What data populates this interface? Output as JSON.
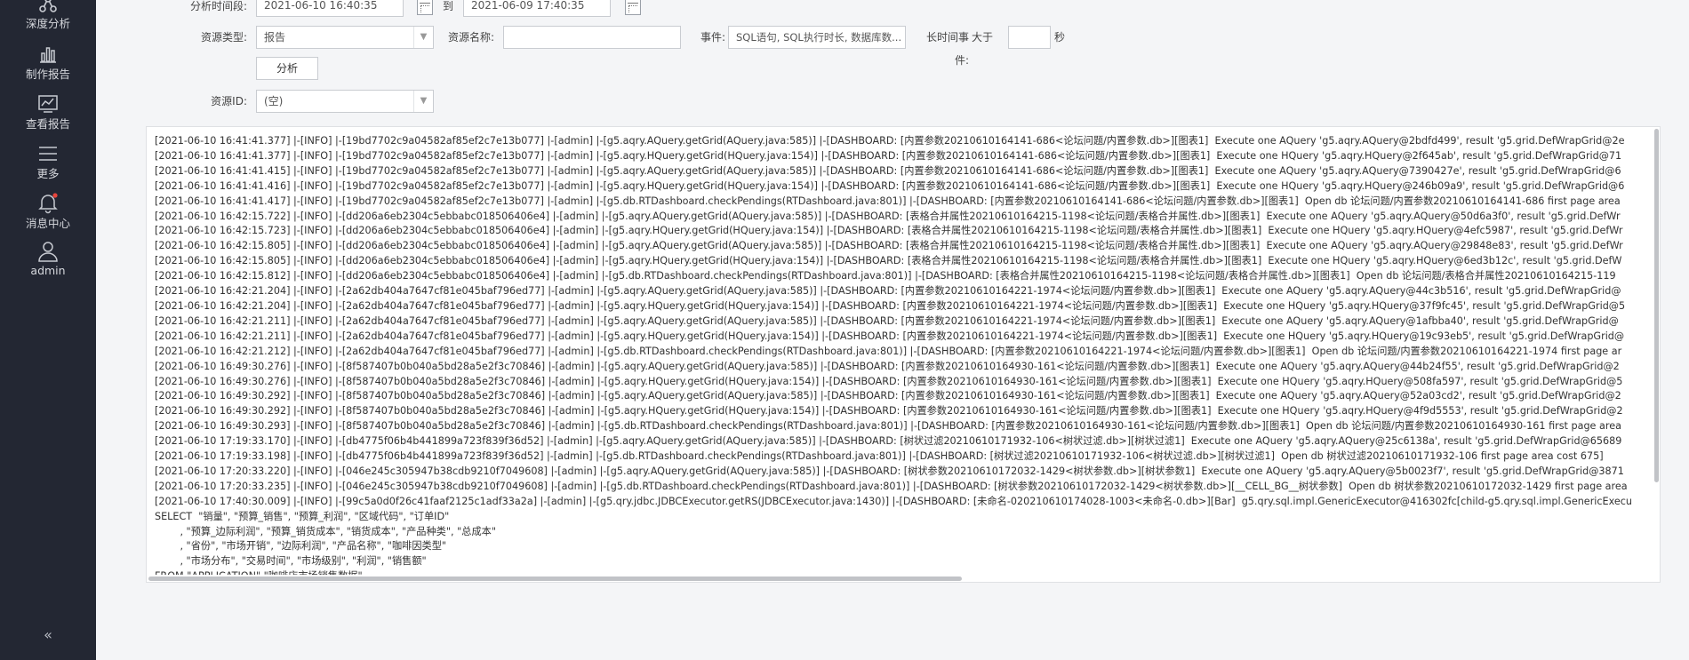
{
  "sidebar": {
    "items": [
      {
        "label": "深度分析",
        "icon": "analysis-icon"
      },
      {
        "label": "制作报告",
        "icon": "bar-chart-icon"
      },
      {
        "label": "查看报告",
        "icon": "line-chart-icon"
      },
      {
        "label": "更多",
        "icon": "menu-icon"
      },
      {
        "label": "消息中心",
        "icon": "bell-icon"
      },
      {
        "label": "admin",
        "icon": "user-icon"
      }
    ],
    "collapse_label": "«"
  },
  "form": {
    "time_label": "分析时间段:",
    "start_time": "2021-06-10 16:40:35",
    "to_label": "到",
    "end_time": "2021-06-09 17:40:35",
    "resource_type_label": "资源类型:",
    "resource_type_value": "报告",
    "resource_name_label": "资源名称:",
    "resource_name_value": "",
    "event_label": "事件:",
    "event_value": "SQL语句, SQL执行时长, 数据库数...",
    "long_event_label": "长时间事件:",
    "greater_label": "大于",
    "long_event_value": "",
    "seconds_label": "秒",
    "analyze_button": "分析",
    "resource_id_label": "资源ID:",
    "resource_id_value": "(空)"
  },
  "log": {
    "lines": [
      "[2021-06-10 16:41:41.377] |-[INFO] |-[19bd7702c9a04582af85ef2c7e13b077] |-[admin] |-[g5.aqry.AQuery.getGrid(AQuery.java:585)] |-[DASHBOARD: [内置参数20210610164141-686<论坛问题/内置参数.db>][图表1]  Execute one AQuery 'g5.aqry.AQuery@2bdfd499', result 'g5.grid.DefWrapGrid@2e",
      "[2021-06-10 16:41:41.377] |-[INFO] |-[19bd7702c9a04582af85ef2c7e13b077] |-[admin] |-[g5.aqry.HQuery.getGrid(HQuery.java:154)] |-[DASHBOARD: [内置参数20210610164141-686<论坛问题/内置参数.db>][图表1]  Execute one HQuery 'g5.aqry.HQuery@2f645ab', result 'g5.grid.DefWrapGrid@71",
      "[2021-06-10 16:41:41.415] |-[INFO] |-[19bd7702c9a04582af85ef2c7e13b077] |-[admin] |-[g5.aqry.AQuery.getGrid(AQuery.java:585)] |-[DASHBOARD: [内置参数20210610164141-686<论坛问题/内置参数.db>][图表1]  Execute one AQuery 'g5.aqry.AQuery@7390427e', result 'g5.grid.DefWrapGrid@6",
      "[2021-06-10 16:41:41.416] |-[INFO] |-[19bd7702c9a04582af85ef2c7e13b077] |-[admin] |-[g5.aqry.HQuery.getGrid(HQuery.java:154)] |-[DASHBOARD: [内置参数20210610164141-686<论坛问题/内置参数.db>][图表1]  Execute one HQuery 'g5.aqry.HQuery@246b09a9', result 'g5.grid.DefWrapGrid@6",
      "[2021-06-10 16:41:41.417] |-[INFO] |-[19bd7702c9a04582af85ef2c7e13b077] |-[admin] |-[g5.db.RTDashboard.checkPendings(RTDashboard.java:801)] |-[DASHBOARD: [内置参数20210610164141-686<论坛问题/内置参数.db>][图表1]  Open db 论坛问题/内置参数20210610164141-686 first page area",
      "[2021-06-10 16:42:15.722] |-[INFO] |-[dd206a6eb2304c5ebbabc018506406e4] |-[admin] |-[g5.aqry.AQuery.getGrid(AQuery.java:585)] |-[DASHBOARD: [表格合并属性20210610164215-1198<论坛问题/表格合并属性.db>][图表1]  Execute one AQuery 'g5.aqry.AQuery@50d6a3f0', result 'g5.grid.DefWr",
      "[2021-06-10 16:42:15.723] |-[INFO] |-[dd206a6eb2304c5ebbabc018506406e4] |-[admin] |-[g5.aqry.HQuery.getGrid(HQuery.java:154)] |-[DASHBOARD: [表格合并属性20210610164215-1198<论坛问题/表格合并属性.db>][图表1]  Execute one HQuery 'g5.aqry.HQuery@4efc5987', result 'g5.grid.DefWr",
      "[2021-06-10 16:42:15.805] |-[INFO] |-[dd206a6eb2304c5ebbabc018506406e4] |-[admin] |-[g5.aqry.AQuery.getGrid(AQuery.java:585)] |-[DASHBOARD: [表格合并属性20210610164215-1198<论坛问题/表格合并属性.db>][图表1]  Execute one AQuery 'g5.aqry.AQuery@29848e83', result 'g5.grid.DefWr",
      "[2021-06-10 16:42:15.805] |-[INFO] |-[dd206a6eb2304c5ebbabc018506406e4] |-[admin] |-[g5.aqry.HQuery.getGrid(HQuery.java:154)] |-[DASHBOARD: [表格合并属性20210610164215-1198<论坛问题/表格合并属性.db>][图表1]  Execute one HQuery 'g5.aqry.HQuery@6ed3b12c', result 'g5.grid.DefW",
      "[2021-06-10 16:42:15.812] |-[INFO] |-[dd206a6eb2304c5ebbabc018506406e4] |-[admin] |-[g5.db.RTDashboard.checkPendings(RTDashboard.java:801)] |-[DASHBOARD: [表格合并属性20210610164215-1198<论坛问题/表格合并属性.db>][图表1]  Open db 论坛问题/表格合并属性20210610164215-119",
      "[2021-06-10 16:42:21.204] |-[INFO] |-[2a62db404a7647cf81e045baf796ed77] |-[admin] |-[g5.aqry.AQuery.getGrid(AQuery.java:585)] |-[DASHBOARD: [内置参数20210610164221-1974<论坛问题/内置参数.db>][图表1]  Execute one AQuery 'g5.aqry.AQuery@44c3b516', result 'g5.grid.DefWrapGrid@",
      "[2021-06-10 16:42:21.204] |-[INFO] |-[2a62db404a7647cf81e045baf796ed77] |-[admin] |-[g5.aqry.HQuery.getGrid(HQuery.java:154)] |-[DASHBOARD: [内置参数20210610164221-1974<论坛问题/内置参数.db>][图表1]  Execute one HQuery 'g5.aqry.HQuery@37f9fc45', result 'g5.grid.DefWrapGrid@5",
      "[2021-06-10 16:42:21.211] |-[INFO] |-[2a62db404a7647cf81e045baf796ed77] |-[admin] |-[g5.aqry.AQuery.getGrid(AQuery.java:585)] |-[DASHBOARD: [内置参数20210610164221-1974<论坛问题/内置参数.db>][图表1]  Execute one AQuery 'g5.aqry.AQuery@1afbba40', result 'g5.grid.DefWrapGrid@",
      "[2021-06-10 16:42:21.211] |-[INFO] |-[2a62db404a7647cf81e045baf796ed77] |-[admin] |-[g5.aqry.HQuery.getGrid(HQuery.java:154)] |-[DASHBOARD: [内置参数20210610164221-1974<论坛问题/内置参数.db>][图表1]  Execute one HQuery 'g5.aqry.HQuery@19c93eb5', result 'g5.grid.DefWrapGrid@",
      "[2021-06-10 16:42:21.212] |-[INFO] |-[2a62db404a7647cf81e045baf796ed77] |-[admin] |-[g5.db.RTDashboard.checkPendings(RTDashboard.java:801)] |-[DASHBOARD: [内置参数20210610164221-1974<论坛问题/内置参数.db>][图表1]  Open db 论坛问题/内置参数20210610164221-1974 first page ar",
      "[2021-06-10 16:49:30.276] |-[INFO] |-[8f587407b0b040a5bd28a5e2f3c70846] |-[admin] |-[g5.aqry.AQuery.getGrid(AQuery.java:585)] |-[DASHBOARD: [内置参数20210610164930-161<论坛问题/内置参数.db>][图表1]  Execute one AQuery 'g5.aqry.AQuery@44b24f55', result 'g5.grid.DefWrapGrid@2",
      "[2021-06-10 16:49:30.276] |-[INFO] |-[8f587407b0b040a5bd28a5e2f3c70846] |-[admin] |-[g5.aqry.HQuery.getGrid(HQuery.java:154)] |-[DASHBOARD: [内置参数20210610164930-161<论坛问题/内置参数.db>][图表1]  Execute one HQuery 'g5.aqry.HQuery@508fa597', result 'g5.grid.DefWrapGrid@5",
      "[2021-06-10 16:49:30.292] |-[INFO] |-[8f587407b0b040a5bd28a5e2f3c70846] |-[admin] |-[g5.aqry.AQuery.getGrid(AQuery.java:585)] |-[DASHBOARD: [内置参数20210610164930-161<论坛问题/内置参数.db>][图表1]  Execute one AQuery 'g5.aqry.AQuery@52a03cd2', result 'g5.grid.DefWrapGrid@2",
      "[2021-06-10 16:49:30.292] |-[INFO] |-[8f587407b0b040a5bd28a5e2f3c70846] |-[admin] |-[g5.aqry.HQuery.getGrid(HQuery.java:154)] |-[DASHBOARD: [内置参数20210610164930-161<论坛问题/内置参数.db>][图表1]  Execute one HQuery 'g5.aqry.HQuery@4f9d5553', result 'g5.grid.DefWrapGrid@2",
      "[2021-06-10 16:49:30.293] |-[INFO] |-[8f587407b0b040a5bd28a5e2f3c70846] |-[admin] |-[g5.db.RTDashboard.checkPendings(RTDashboard.java:801)] |-[DASHBOARD: [内置参数20210610164930-161<论坛问题/内置参数.db>][图表1]  Open db 论坛问题/内置参数20210610164930-161 first page area",
      "[2021-06-10 17:19:33.170] |-[INFO] |-[db4775f06b4b441899a723f839f36d52] |-[admin] |-[g5.aqry.AQuery.getGrid(AQuery.java:585)] |-[DASHBOARD: [树状过滤20210610171932-106<树状过滤.db>][树状过滤1]  Execute one AQuery 'g5.aqry.AQuery@25c6138a', result 'g5.grid.DefWrapGrid@65689",
      "[2021-06-10 17:19:33.198] |-[INFO] |-[db4775f06b4b441899a723f839f36d52] |-[admin] |-[g5.db.RTDashboard.checkPendings(RTDashboard.java:801)] |-[DASHBOARD: [树状过滤20210610171932-106<树状过滤.db>][树状过滤1]  Open db 树状过滤20210610171932-106 first page area cost 675]",
      "[2021-06-10 17:20:33.220] |-[INFO] |-[046e245c305947b38cdb9210f7049608] |-[admin] |-[g5.aqry.AQuery.getGrid(AQuery.java:585)] |-[DASHBOARD: [树状参数20210610172032-1429<树状参数.db>][树状参数1]  Execute one AQuery 'g5.aqry.AQuery@5b0023f7', result 'g5.grid.DefWrapGrid@3871",
      "[2021-06-10 17:20:33.235] |-[INFO] |-[046e245c305947b38cdb9210f7049608] |-[admin] |-[g5.db.RTDashboard.checkPendings(RTDashboard.java:801)] |-[DASHBOARD: [树状参数20210610172032-1429<树状参数.db>][__CELL_BG__树状参数]  Open db 树状参数20210610172032-1429 first page area",
      "[2021-06-10 17:40:30.009] |-[INFO] |-[99c5a0d0f26c41faaf2125c1adf33a2a] |-[admin] |-[g5.qry.jdbc.JDBCExecutor.getRS(JDBCExecutor.java:1430)] |-[DASHBOARD: [未命名-020210610174028-1003<未命名-0.db>][Bar]  g5.qry.sql.impl.GenericExecutor@416302fc[child-g5.qry.sql.impl.GenericExecu",
      "SELECT  \"销量\", \"预算_销售\", \"预算_利润\", \"区域代码\", \"订单ID\"",
      "        , \"预算_边际利润\", \"预算_销货成本\", \"销货成本\", \"产品种类\", \"总成本\"",
      "        , \"省份\", \"市场开销\", \"边际利润\", \"产品名称\", \"咖啡因类型\"",
      "        , \"市场分布\", \"交易时间\", \"市场级别\", \"利润\", \"销售额\"",
      "FROM \"APPLICATION\".\"咖啡店市场销售数据\""
    ]
  }
}
